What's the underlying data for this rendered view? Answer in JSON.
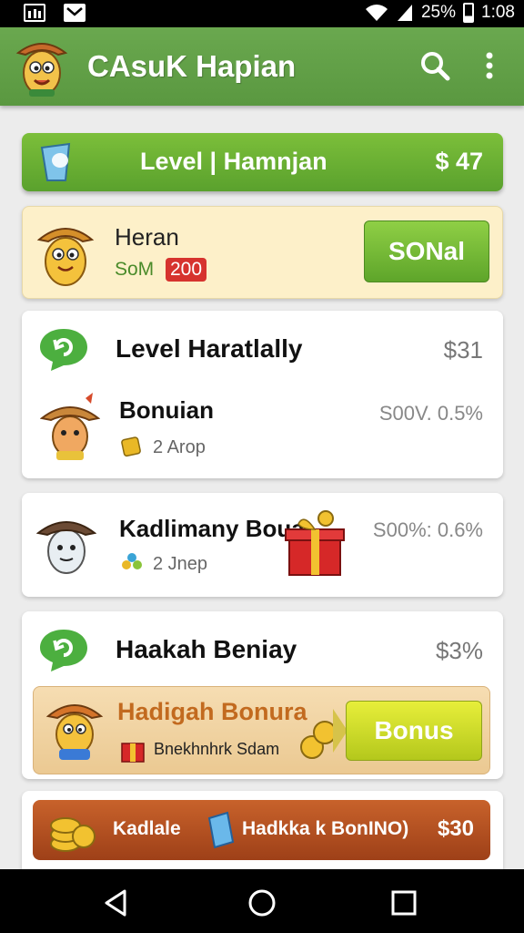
{
  "status_bar": {
    "battery": "25%",
    "time": "1:08"
  },
  "app_bar": {
    "title": "CAsuK Hapian",
    "icons": [
      "mascot-logo-icon",
      "search-icon",
      "more-vert-icon"
    ]
  },
  "level_banner": {
    "title": "Level | Hamnjan",
    "amount": "$ 47"
  },
  "hero": {
    "name": "Heran",
    "sub_label": "SoM",
    "badge": "200",
    "button_label": "SONal"
  },
  "level_section": {
    "title": "Level Haratlally",
    "amount": "$31",
    "row": {
      "name": "Bonuian",
      "meta": "2 Arop",
      "percent": "S00V. 0.5%"
    }
  },
  "kad_section": {
    "name": "Kadlimany Boua",
    "meta": "2 Jnep",
    "percent": "S00%: 0.6%"
  },
  "haak_section": {
    "title": "Haakah Beniay",
    "amount": "$3%",
    "bonus": {
      "title": "Hadigah Bonura",
      "sub_label": "Bnekhnhrk Sdam",
      "button_label": "Bonus"
    }
  },
  "last_strip": {
    "label_left": "Kadlale",
    "label_right": "Hadkka k BonINO)",
    "price": "$30"
  },
  "colors": {
    "appbar": "#6aa84f",
    "banner": "#6cb234",
    "badge": "#d6332e",
    "bonus_button": "#c8d82a",
    "last_strip": "#b55224"
  }
}
